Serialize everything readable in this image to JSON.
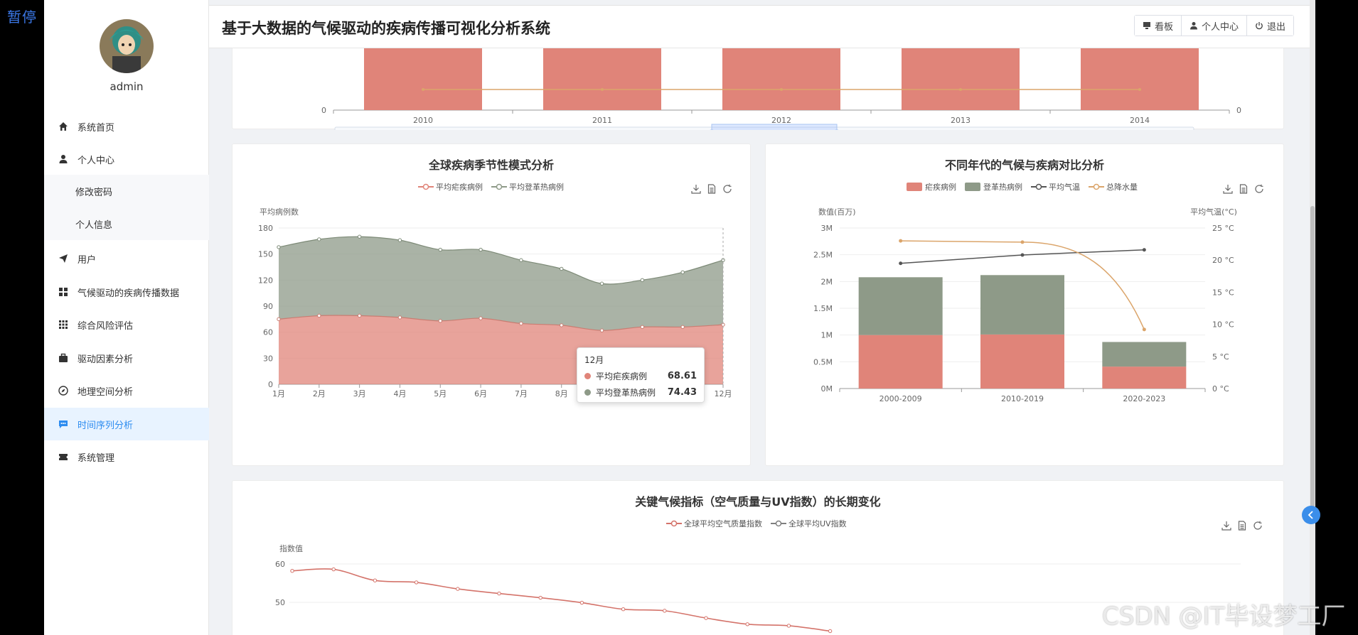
{
  "overlay": {
    "pause_label": "暂停",
    "watermark": "CSDN @IT毕设梦工厂"
  },
  "user": {
    "name": "admin"
  },
  "sidebar": {
    "items": [
      {
        "label": "系统首页",
        "icon": "home-icon"
      },
      {
        "label": "个人中心",
        "icon": "user-icon"
      },
      {
        "label": "修改密码",
        "icon": ""
      },
      {
        "label": "个人信息",
        "icon": ""
      },
      {
        "label": "用户",
        "icon": "send-icon"
      },
      {
        "label": "气候驱动的疾病传播数据",
        "icon": "grid-icon"
      },
      {
        "label": "综合风险评估",
        "icon": "apps-icon"
      },
      {
        "label": "驱动因素分析",
        "icon": "briefcase-icon"
      },
      {
        "label": "地理空间分析",
        "icon": "compass-icon"
      },
      {
        "label": "时间序列分析",
        "icon": "chat-icon"
      },
      {
        "label": "系统管理",
        "icon": "ticket-icon"
      }
    ],
    "active_index": 9
  },
  "header": {
    "title": "基于大数据的气候驱动的疾病传播可视化分析系统",
    "buttons": {
      "board": "看板",
      "profile": "个人中心",
      "logout": "退出"
    }
  },
  "colors": {
    "malaria": "#e08479",
    "dengue": "#8e9a88",
    "temp": "#555555",
    "rain": "#dba56b",
    "active": "#2d8cf0",
    "aqi": "#d4736a",
    "uv": "#7f7f7f"
  },
  "chart_data": [
    {
      "type": "bar",
      "x": [
        "2010",
        "2011",
        "2012",
        "2013",
        "2014"
      ],
      "yleft_ticks": [
        "0"
      ],
      "yright_ticks": [
        "0"
      ]
    },
    {
      "type": "area",
      "title": "全球疾病季节性模式分析",
      "ylabel": "平均病例数",
      "categories": [
        "1月",
        "2月",
        "3月",
        "4月",
        "5月",
        "6月",
        "7月",
        "8月",
        "9月",
        "10月",
        "11月",
        "12月"
      ],
      "series": [
        {
          "name": "平均疟疾病例",
          "values": [
            75,
            79,
            79,
            77,
            73,
            76,
            70,
            68,
            62,
            66,
            66,
            68.61
          ]
        },
        {
          "name": "平均登革热病例",
          "values": [
            83,
            88,
            91,
            89,
            82,
            79,
            73,
            65,
            54,
            54,
            63,
            74.43
          ]
        }
      ],
      "ylim": [
        0,
        180
      ],
      "yticks": [
        "0",
        "30",
        "60",
        "90",
        "120",
        "150",
        "180"
      ],
      "tooltip": {
        "title": "12月",
        "rows": [
          {
            "name": "平均疟疾病例",
            "value": "68.61"
          },
          {
            "name": "平均登革热病例",
            "value": "74.43"
          }
        ]
      }
    },
    {
      "type": "bar",
      "title": "不同年代的气候与疾病对比分析",
      "ylabel": "数值(百万)",
      "ylabel_right": "平均气温(°C)",
      "categories": [
        "2000-2009",
        "2010-2019",
        "2020-2023"
      ],
      "series": [
        {
          "name": "疟疾病例",
          "values": [
            1.0,
            1.01,
            0.41
          ]
        },
        {
          "name": "登革热病例",
          "values": [
            1.08,
            1.11,
            0.46
          ]
        },
        {
          "name": "平均气温",
          "values": [
            19.5,
            20.8,
            21.6
          ]
        },
        {
          "name": "总降水量",
          "values": [
            23,
            22.8,
            9.2
          ]
        }
      ],
      "yticks_left": [
        "0M",
        "0.5M",
        "1M",
        "1.5M",
        "2M",
        "2.5M",
        "3M"
      ],
      "yticks_right": [
        "0 °C",
        "5 °C",
        "10 °C",
        "15 °C",
        "20 °C",
        "25 °C"
      ],
      "ylim": [
        0,
        3
      ],
      "ylim_right": [
        0,
        25
      ]
    },
    {
      "type": "line",
      "title": "关键气候指标（空气质量与UV指数）的长期变化",
      "ylabel": "指数值",
      "series": [
        {
          "name": "全球平均空气质量指数",
          "values": [
            58.2,
            58.6,
            55.7,
            55.2,
            53.5,
            52.3,
            51.2,
            49.9,
            48.2,
            47.8,
            45.9,
            44.3,
            43.9,
            42.5
          ]
        },
        {
          "name": "全球平均UV指数",
          "values": []
        }
      ],
      "yticks": [
        "50",
        "60"
      ]
    }
  ]
}
